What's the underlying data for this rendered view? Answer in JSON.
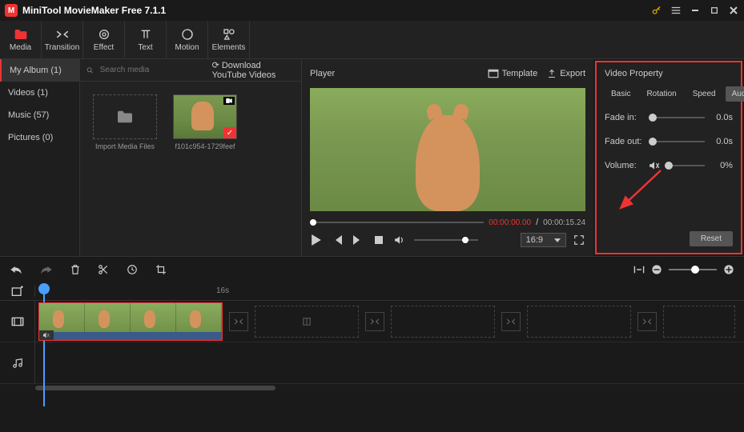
{
  "app": {
    "title": "MiniTool MovieMaker Free 7.1.1"
  },
  "toolbar": [
    {
      "label": "Media",
      "active": true
    },
    {
      "label": "Transition"
    },
    {
      "label": "Effect"
    },
    {
      "label": "Text"
    },
    {
      "label": "Motion"
    },
    {
      "label": "Elements"
    }
  ],
  "sidebar": {
    "album": "My Album (1)",
    "items": [
      {
        "label": "Videos (1)"
      },
      {
        "label": "Music (57)"
      },
      {
        "label": "Pictures (0)"
      }
    ]
  },
  "media": {
    "search_placeholder": "Search media",
    "download": "Download YouTube Videos",
    "import": "Import Media Files",
    "clip_name": "f101c954-1729feef"
  },
  "player": {
    "title": "Player",
    "template": "Template",
    "export": "Export",
    "time_current": "00:00:00.00",
    "time_sep": " / ",
    "time_total": "00:00:15.24",
    "aspect": "16:9"
  },
  "property": {
    "title": "Video Property",
    "tabs": [
      "Basic",
      "Rotation",
      "Speed",
      "Audio"
    ],
    "active_tab": "Audio",
    "fade_in": {
      "label": "Fade in:",
      "value": "0.0s"
    },
    "fade_out": {
      "label": "Fade out:",
      "value": "0.0s"
    },
    "volume": {
      "label": "Volume:",
      "value": "0%"
    },
    "reset": "Reset"
  },
  "timeline": {
    "marker": "16s"
  }
}
